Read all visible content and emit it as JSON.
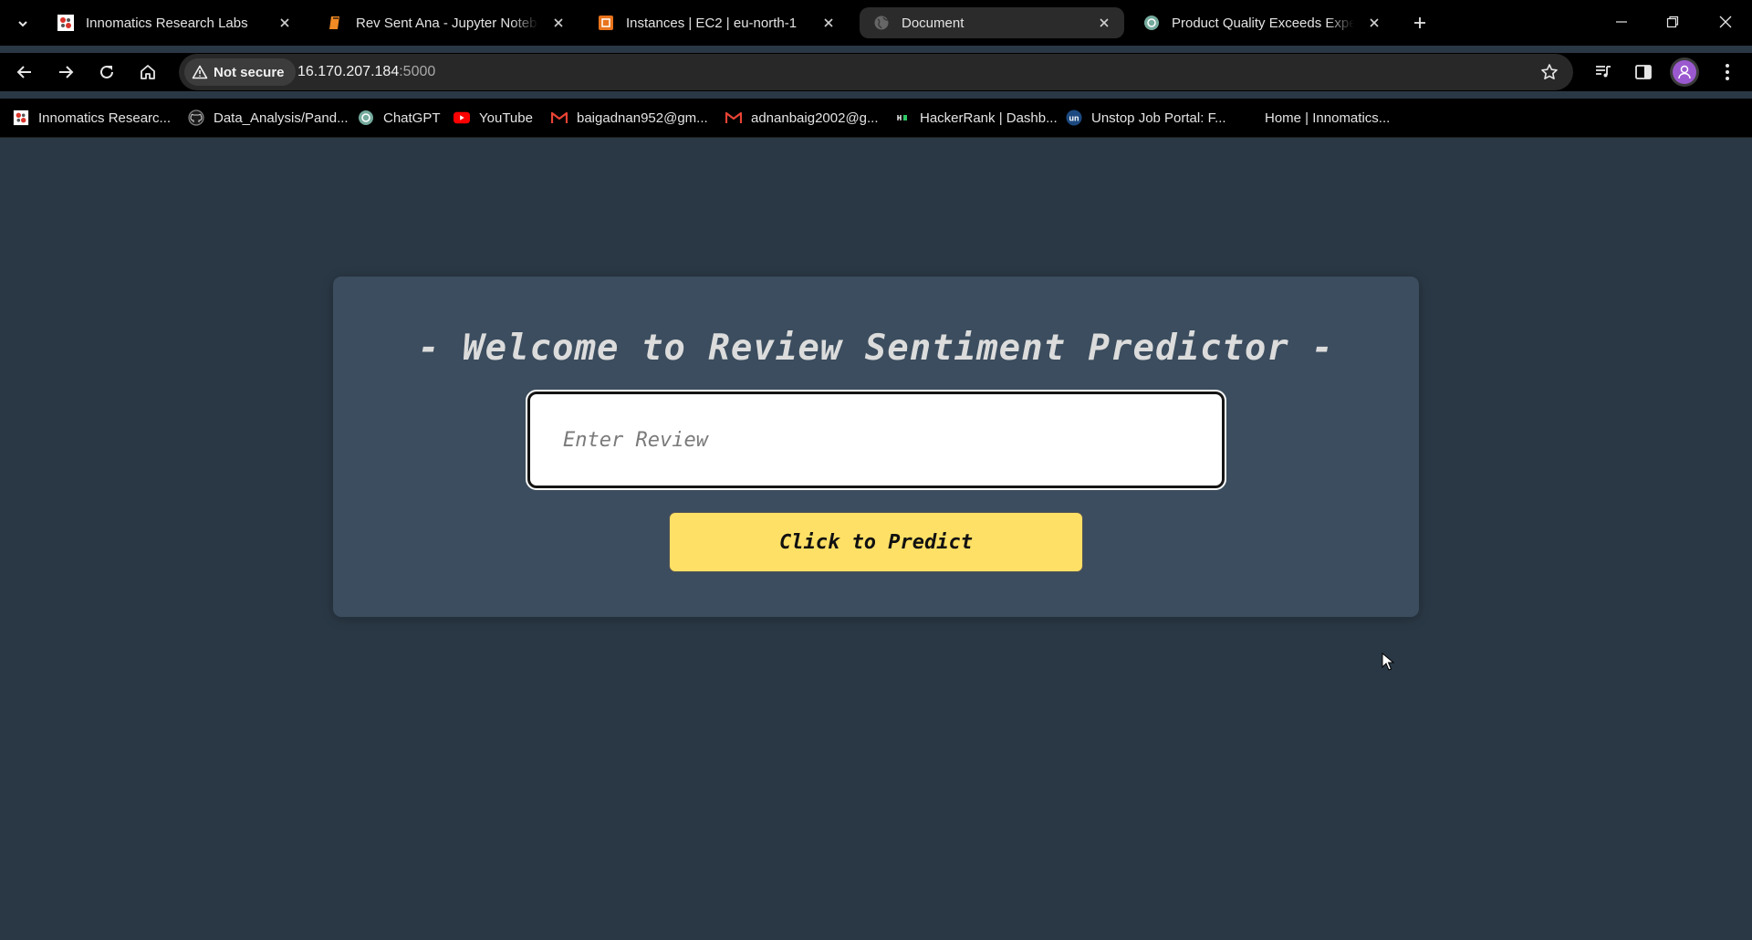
{
  "browser": {
    "tabs": [
      {
        "title": "Innomatics Research Labs",
        "favicon": "innomatics-icon",
        "active": false
      },
      {
        "title": "Rev Sent Ana - Jupyter Notebook",
        "favicon": "jupyter-icon",
        "active": false
      },
      {
        "title": "Instances | EC2 | eu-north-1",
        "favicon": "aws-ec2-icon",
        "active": false
      },
      {
        "title": "Document",
        "favicon": "globe-icon",
        "active": true
      },
      {
        "title": "Product Quality Exceeds Expectations",
        "favicon": "chatgpt-icon",
        "active": false
      }
    ],
    "security_label": "Not secure",
    "url_host": "16.170.207.184",
    "url_port": ":5000",
    "bookmarks": [
      {
        "label": "Innomatics Researc...",
        "icon": "innomatics-icon"
      },
      {
        "label": "Data_Analysis/Pand...",
        "icon": "github-icon"
      },
      {
        "label": "ChatGPT",
        "icon": "chatgpt-icon"
      },
      {
        "label": "YouTube",
        "icon": "youtube-icon"
      },
      {
        "label": "baigadnan952@gm...",
        "icon": "gmail-icon"
      },
      {
        "label": "adnanbaig2002@g...",
        "icon": "gmail-icon"
      },
      {
        "label": "HackerRank | Dashb...",
        "icon": "hackerrank-icon"
      },
      {
        "label": "Unstop Job Portal: F...",
        "icon": "unstop-icon"
      },
      {
        "label": "Home | Innomatics...",
        "icon": ""
      }
    ]
  },
  "app": {
    "heading": "- Welcome to Review Sentiment Predictor -",
    "input_placeholder": "Enter Review",
    "input_value": "",
    "predict_label": "Click to Predict"
  },
  "colors": {
    "page_bg": "#2a3845",
    "card_bg": "#3b4d5e",
    "button_bg": "#ffe066",
    "heading": "#dcdcdc"
  }
}
